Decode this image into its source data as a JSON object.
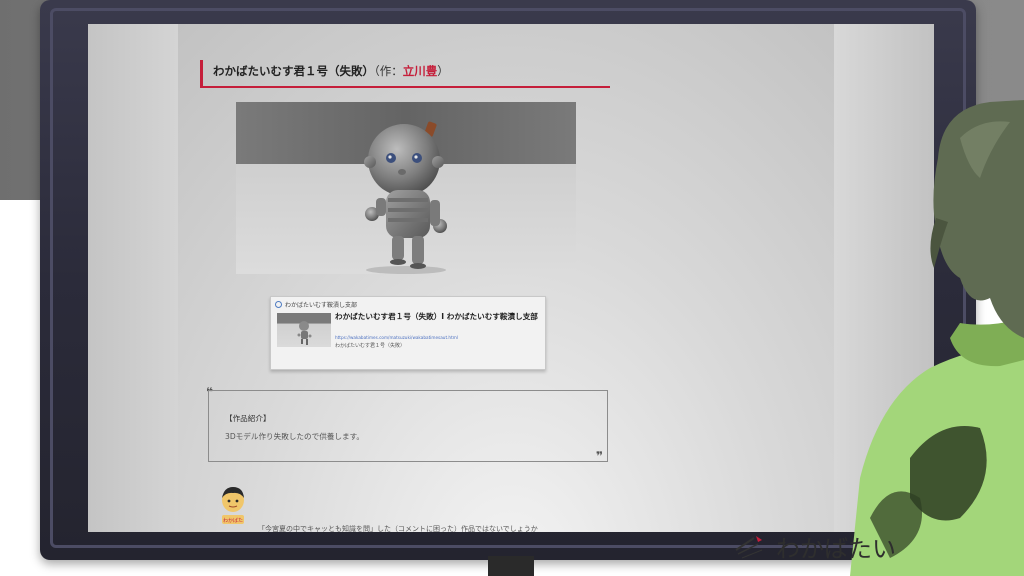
{
  "article": {
    "title_main": "わかばたいむす君１号（失敗）",
    "title_credit_prefix": "（作：",
    "title_author": "立川豊",
    "title_credit_suffix": "）"
  },
  "link_card": {
    "site_name": "わかばたいむす鞍漬し支部",
    "title": "わかばたいむす君１号（失敗）I わかばたいむす鞍漬し支部",
    "url": "https://wakabatimes.com/matsuzuki/wakabatimesaut.html",
    "description": "わかばたいむす君１号（失敗）"
  },
  "quote": {
    "open_mark": "❝",
    "heading": "【作品紹介】",
    "body": "3Dモデル作り失敗したので供養します。",
    "close_mark": "❞"
  },
  "comment": {
    "avatar_label": "わかばた",
    "text": "「今宮夏の中でキャッとも知識を問」した（コメントに困った）作品ではないでしょうか"
  },
  "watermark": {
    "text": "わかばたい"
  },
  "colors": {
    "accent": "#c51e3a",
    "monitor_frame": "#2b2b3a",
    "character_shirt": "#9ccf6a",
    "character_hair": "#5f6b52"
  }
}
